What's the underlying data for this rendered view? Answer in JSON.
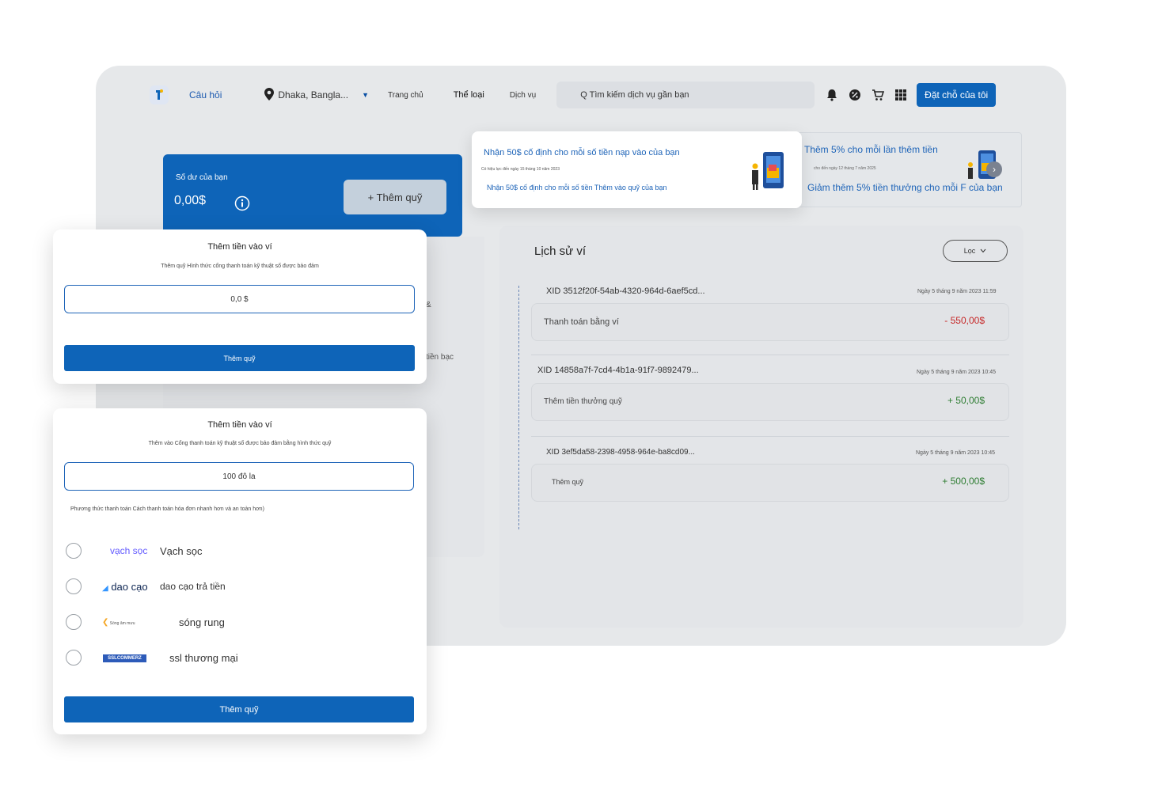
{
  "header": {
    "faq": "Câu hỏi",
    "location": "Dhaka, Bangla...",
    "nav": [
      "Trang chủ",
      "Thể loại",
      "Dịch vụ"
    ],
    "search_placeholder": "Q Tìm kiếm dịch vụ gần bạn",
    "book_button": "Đặt chỗ của tôi",
    "icons": [
      "bell-icon",
      "discount-icon",
      "cart-icon",
      "apps-grid-icon"
    ]
  },
  "balance": {
    "label": "Số dư của bạn",
    "value": "0,00$",
    "add_fund": "+ Thêm quỹ"
  },
  "left_panel_fragments": [
    "&",
    "tiền bạc"
  ],
  "promos": [
    {
      "title": "Nhận 50$ cố định cho mỗi số tiền nạp vào của bạn",
      "validity": "Có hiệu lực đến ngày 15 tháng 10 năm 2023",
      "text": "Nhận 50$ cố định cho mỗi số tiền Thêm vào quỹ của bạn"
    },
    {
      "title": "Thêm 5% cho mỗi lần thêm tiền",
      "validity": "cho đến ngày 12 tháng 7 năm 2025",
      "text": "Giảm thêm 5% tiền thưởng cho mỗi F của bạn"
    }
  ],
  "history": {
    "title": "Lịch sử ví",
    "filter": "Lọc",
    "transactions": [
      {
        "xid": "XID 3512f20f-54ab-4320-964d-6aef5cd...",
        "date": "Ngày 5 tháng 9 năm 2023 11:59",
        "desc": "Thanh toán bằng ví",
        "amount": "- 550,00$",
        "sign": "neg"
      },
      {
        "xid": "XID 14858a7f-7cd4-4b1a-91f7-9892479...",
        "date": "Ngày 5 tháng 9 năm 2023 10:45",
        "desc": "Thêm tiền thưởng quỹ",
        "amount": "+ 50,00$",
        "sign": "pos"
      },
      {
        "xid": "XID 3ef5da58-2398-4958-964e-ba8cd09...",
        "date": "Ngày 5 tháng 9 năm 2023 10:45",
        "desc": "Thêm quỹ",
        "amount": "+ 500,00$",
        "sign": "pos"
      }
    ]
  },
  "modal1": {
    "title": "Thêm tiền vào ví",
    "subtitle": "Thêm quỹ Hình thức cổng thanh toán kỹ thuật số được bảo đảm",
    "input_value": "0,0 $",
    "button": "Thêm quỹ"
  },
  "modal2": {
    "title": "Thêm tiền vào ví",
    "subtitle": "Thêm vào Cổng thanh toán kỹ thuật số được bảo đảm bằng hình thức quỹ",
    "input_value": "100 đô la",
    "payment_note": "Phương thức thanh toán Cách thanh toán hóa đơn nhanh hơn và an toàn hơn)",
    "methods": [
      {
        "logo": "vạch sọc",
        "label": "Vạch sọc"
      },
      {
        "logo": "dao cạo",
        "label": "dao cạo trả tiền"
      },
      {
        "logo": "Sóng âm mưu",
        "label": "sóng rung"
      },
      {
        "logo": "SSLCOMMERZ",
        "label": "ssl thương mại"
      }
    ],
    "button": "Thêm quỹ"
  }
}
